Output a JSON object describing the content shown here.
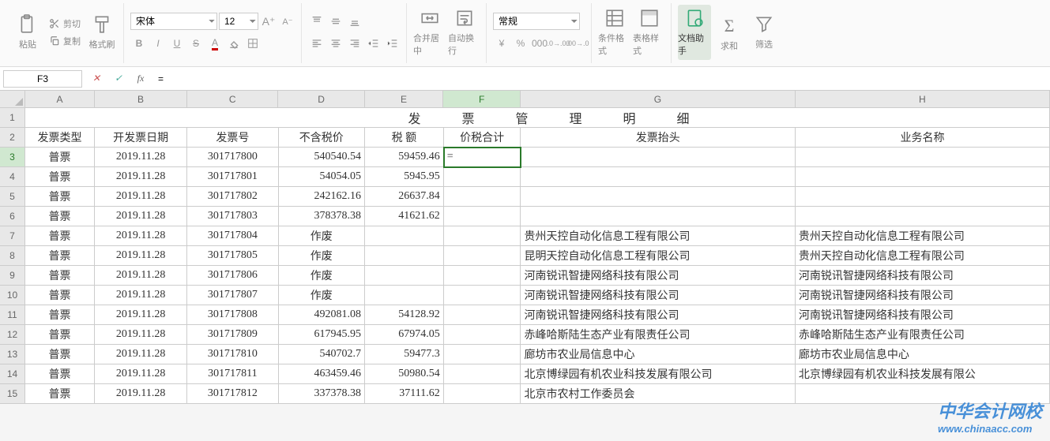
{
  "ribbon": {
    "paste": "粘贴",
    "cut": "剪切",
    "copy": "复制",
    "format_painter": "格式刷",
    "font_name": "宋体",
    "font_size": "12",
    "merge_center": "合并居中",
    "wrap_text": "自动换行",
    "number_format": "常规",
    "cond_format": "条件格式",
    "cell_styles": "表格样式",
    "doc_assist": "文档助手",
    "sum": "求和",
    "filter": "筛选"
  },
  "formula": {
    "cell_ref": "F3",
    "content": "="
  },
  "columns": [
    "A",
    "B",
    "C",
    "D",
    "E",
    "F",
    "G",
    "H"
  ],
  "colwidths": [
    "cA",
    "cB",
    "cC",
    "cD",
    "cE",
    "cF",
    "cG",
    "cH"
  ],
  "title": "发票管理明细",
  "headers": [
    "发票类型",
    "开发票日期",
    "发票号",
    "不含税价",
    "税 额",
    "价税合计",
    "发票抬头",
    "业务名称"
  ],
  "rows": [
    {
      "r": 3,
      "a": "普票",
      "b": "2019.11.28",
      "c": "301717800",
      "d": "540540.54",
      "e": "59459.46",
      "f": "=",
      "g": "",
      "h": "",
      "edit": true
    },
    {
      "r": 4,
      "a": "普票",
      "b": "2019.11.28",
      "c": "301717801",
      "d": "54054.05",
      "e": "5945.95",
      "f": "",
      "g": "",
      "h": ""
    },
    {
      "r": 5,
      "a": "普票",
      "b": "2019.11.28",
      "c": "301717802",
      "d": "242162.16",
      "e": "26637.84",
      "f": "",
      "g": "",
      "h": ""
    },
    {
      "r": 6,
      "a": "普票",
      "b": "2019.11.28",
      "c": "301717803",
      "d": "378378.38",
      "e": "41621.62",
      "f": "",
      "g": "",
      "h": ""
    },
    {
      "r": 7,
      "a": "普票",
      "b": "2019.11.28",
      "c": "301717804",
      "d": "作废",
      "e": "",
      "f": "",
      "g": "贵州天控自动化信息工程有限公司",
      "h": "贵州天控自动化信息工程有限公司"
    },
    {
      "r": 8,
      "a": "普票",
      "b": "2019.11.28",
      "c": "301717805",
      "d": "作废",
      "e": "",
      "f": "",
      "g": "昆明天控自动化信息工程有限公司",
      "h": "贵州天控自动化信息工程有限公司"
    },
    {
      "r": 9,
      "a": "普票",
      "b": "2019.11.28",
      "c": "301717806",
      "d": "作废",
      "e": "",
      "f": "",
      "g": "河南锐讯智捷网络科技有限公司",
      "h": "河南锐讯智捷网络科技有限公司"
    },
    {
      "r": 10,
      "a": "普票",
      "b": "2019.11.28",
      "c": "301717807",
      "d": "作废",
      "e": "",
      "f": "",
      "g": "河南锐讯智捷网络科技有限公司",
      "h": "河南锐讯智捷网络科技有限公司"
    },
    {
      "r": 11,
      "a": "普票",
      "b": "2019.11.28",
      "c": "301717808",
      "d": "492081.08",
      "e": "54128.92",
      "f": "",
      "g": "河南锐讯智捷网络科技有限公司",
      "h": "河南锐讯智捷网络科技有限公司"
    },
    {
      "r": 12,
      "a": "普票",
      "b": "2019.11.28",
      "c": "301717809",
      "d": "617945.95",
      "e": "67974.05",
      "f": "",
      "g": "赤峰哈斯陆生态产业有限责任公司",
      "h": "赤峰哈斯陆生态产业有限责任公司"
    },
    {
      "r": 13,
      "a": "普票",
      "b": "2019.11.28",
      "c": "301717810",
      "d": "540702.7",
      "e": "59477.3",
      "f": "",
      "g": "廊坊市农业局信息中心",
      "h": "廊坊市农业局信息中心"
    },
    {
      "r": 14,
      "a": "普票",
      "b": "2019.11.28",
      "c": "301717811",
      "d": "463459.46",
      "e": "50980.54",
      "f": "",
      "g": "北京博绿园有机农业科技发展有限公司",
      "h": "北京博绿园有机农业科技发展有限公"
    },
    {
      "r": 15,
      "a": "普票",
      "b": "2019.11.28",
      "c": "301717812",
      "d": "337378.38",
      "e": "37111.62",
      "f": "",
      "g": "北京市农村工作委员会",
      "h": ""
    }
  ],
  "watermark": {
    "main": "中华会计网校",
    "sub": "www.chinaacc.com"
  }
}
